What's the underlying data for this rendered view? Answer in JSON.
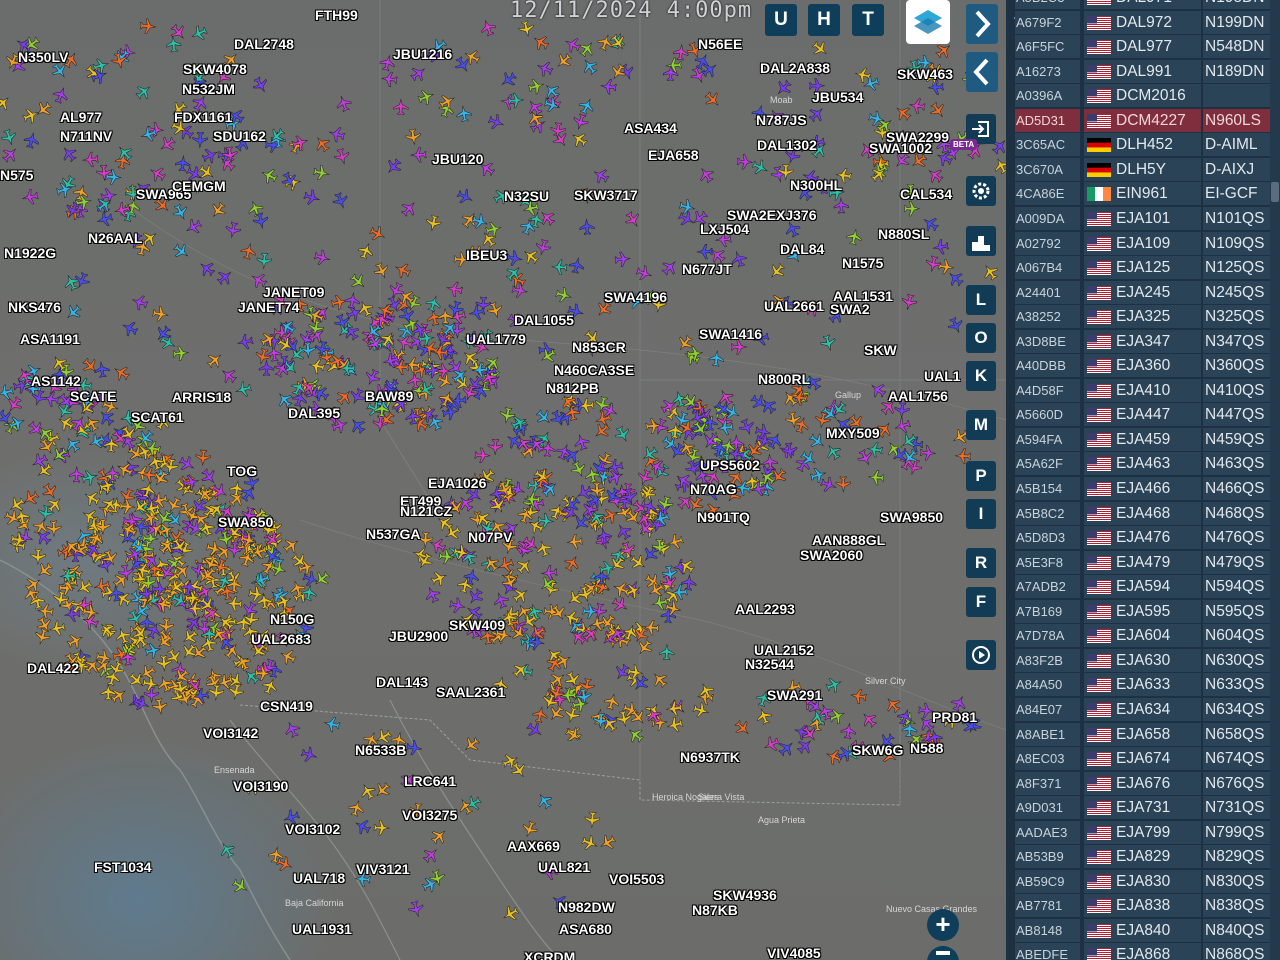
{
  "timestamp": "12/11/2024 4:00pm",
  "top_buttons": [
    "U",
    "H",
    "T"
  ],
  "side_buttons": [
    "L",
    "O",
    "K",
    "M",
    "P",
    "I",
    "R",
    "F"
  ],
  "beta_badge": "BETA",
  "zoom_in": "+",
  "places": [
    {
      "name": "Moab"
    },
    {
      "name": "Gallup"
    },
    {
      "name": "Silver City"
    },
    {
      "name": "Heroica Nogales"
    },
    {
      "name": "Sierra Vista"
    },
    {
      "name": "Agua Prieta"
    },
    {
      "name": "Ensenada"
    },
    {
      "name": "Nuevo Casas Grandes"
    },
    {
      "name": "Baja California"
    }
  ],
  "flights": [
    {
      "label": "FTH99"
    },
    {
      "label": "DAL2748"
    },
    {
      "label": "SKW4078"
    },
    {
      "label": "N532JM"
    },
    {
      "label": "JBU1216"
    },
    {
      "label": "N350LV"
    },
    {
      "label": "AL977"
    },
    {
      "label": "N711NV"
    },
    {
      "label": "FDX1161"
    },
    {
      "label": "SDU162"
    },
    {
      "label": "N56EE"
    },
    {
      "label": "DAL2A838"
    },
    {
      "label": "SKW463"
    },
    {
      "label": "JBU534"
    },
    {
      "label": "N787JS"
    },
    {
      "label": "DAL1302"
    },
    {
      "label": "SWA1002"
    },
    {
      "label": "ASA434"
    },
    {
      "label": "EJA658"
    },
    {
      "label": "N300HL"
    },
    {
      "label": "CAL534"
    },
    {
      "label": "SWA965"
    },
    {
      "label": "N32SU"
    },
    {
      "label": "SKW3717"
    },
    {
      "label": "LXJ504"
    },
    {
      "label": "SWA2EXJ376"
    },
    {
      "label": "JANET09"
    },
    {
      "label": "ASA1191"
    },
    {
      "label": "NKS476"
    },
    {
      "label": "N1922G"
    },
    {
      "label": "SWA4196"
    },
    {
      "label": "SWA1416"
    },
    {
      "label": "UAL2661"
    },
    {
      "label": "N677JT"
    },
    {
      "label": "DAL1055"
    },
    {
      "label": "N853CR"
    },
    {
      "label": "N460CA3SE"
    },
    {
      "label": "N812PB"
    },
    {
      "label": "N800RL"
    },
    {
      "label": "AAL1756"
    },
    {
      "label": "ARRIS18"
    },
    {
      "label": "SCAT61"
    },
    {
      "label": "AS1142"
    },
    {
      "label": "MXY509"
    },
    {
      "label": "UPS5602"
    },
    {
      "label": "N901TQ"
    },
    {
      "label": "N70AG"
    },
    {
      "label": "SWA2060"
    },
    {
      "label": "AAN888GL"
    },
    {
      "label": "N537GA"
    },
    {
      "label": "JBU2900"
    },
    {
      "label": "SKW409"
    },
    {
      "label": "AAL2293"
    },
    {
      "label": "UAL2152"
    },
    {
      "label": "N32544"
    },
    {
      "label": "SWA291"
    },
    {
      "label": "DAL422"
    },
    {
      "label": "SAAL2361"
    },
    {
      "label": "CSN419"
    },
    {
      "label": "VOI3142"
    },
    {
      "label": "VOI3190"
    },
    {
      "label": "LRC641"
    },
    {
      "label": "N6533B"
    },
    {
      "label": "VOI3275"
    },
    {
      "label": "VOI3102"
    },
    {
      "label": "AAX669"
    },
    {
      "label": "UAL821"
    },
    {
      "label": "VOI5503"
    },
    {
      "label": "FST1034"
    },
    {
      "label": "UAL718"
    },
    {
      "label": "VIV3121"
    },
    {
      "label": "UAL1931"
    },
    {
      "label": "N982DW"
    },
    {
      "label": "ASA680"
    },
    {
      "label": "SKW4936"
    },
    {
      "label": "N87KB"
    },
    {
      "label": "VIV4085"
    },
    {
      "label": "N6937TK"
    },
    {
      "label": "PRD81"
    },
    {
      "label": "N588"
    },
    {
      "label": "SKW6G"
    },
    {
      "label": "DAL84"
    },
    {
      "label": "N880SL"
    },
    {
      "label": "JANET74"
    },
    {
      "label": "SCATE"
    },
    {
      "label": "TOG"
    },
    {
      "label": "UAL1779"
    },
    {
      "label": "BAW89"
    },
    {
      "label": "ET499"
    },
    {
      "label": "N121CZ"
    },
    {
      "label": "N07PV"
    },
    {
      "label": "SWA850"
    },
    {
      "label": "EJA1026"
    },
    {
      "label": "IBEU3"
    },
    {
      "label": "XCRDM"
    },
    {
      "label": "DAL395"
    },
    {
      "label": "SWA9850"
    },
    {
      "label": "N150G"
    },
    {
      "label": "UAL2683"
    },
    {
      "label": "DAL143"
    },
    {
      "label": "N1575"
    },
    {
      "label": "AAL1531"
    },
    {
      "label": "SKW"
    },
    {
      "label": "SWA2"
    },
    {
      "label": "N575"
    },
    {
      "label": "N26AAL"
    },
    {
      "label": "CEMGM"
    },
    {
      "label": "UAL1"
    },
    {
      "label": "JBU120"
    },
    {
      "label": "SWA2299"
    }
  ],
  "aircraft_list": [
    {
      "hex": "A5B2C3",
      "country": "us",
      "callsign": "DAL971",
      "reg": "N198DN"
    },
    {
      "hex": "A679F2",
      "country": "us",
      "callsign": "DAL972",
      "reg": "N199DN"
    },
    {
      "hex": "A6F5FC",
      "country": "us",
      "callsign": "DAL977",
      "reg": "N548DN"
    },
    {
      "hex": "A16273",
      "country": "us",
      "callsign": "DAL991",
      "reg": "N189DN"
    },
    {
      "hex": "A0396A",
      "country": "us",
      "callsign": "DCM2016",
      "reg": ""
    },
    {
      "hex": "AD5D31",
      "country": "us",
      "callsign": "DCM4227",
      "reg": "N960LS",
      "selected": true
    },
    {
      "hex": "3C65AC",
      "country": "de",
      "callsign": "DLH452",
      "reg": "D-AIML"
    },
    {
      "hex": "3C670A",
      "country": "de",
      "callsign": "DLH5Y",
      "reg": "D-AIXJ"
    },
    {
      "hex": "4CA86E",
      "country": "ie",
      "callsign": "EIN961",
      "reg": "EI-GCF"
    },
    {
      "hex": "A009DA",
      "country": "us",
      "callsign": "EJA101",
      "reg": "N101QS"
    },
    {
      "hex": "A02792",
      "country": "us",
      "callsign": "EJA109",
      "reg": "N109QS"
    },
    {
      "hex": "A067B4",
      "country": "us",
      "callsign": "EJA125",
      "reg": "N125QS"
    },
    {
      "hex": "A24401",
      "country": "us",
      "callsign": "EJA245",
      "reg": "N245QS"
    },
    {
      "hex": "A38252",
      "country": "us",
      "callsign": "EJA325",
      "reg": "N325QS"
    },
    {
      "hex": "A3D8BE",
      "country": "us",
      "callsign": "EJA347",
      "reg": "N347QS"
    },
    {
      "hex": "A40DBB",
      "country": "us",
      "callsign": "EJA360",
      "reg": "N360QS"
    },
    {
      "hex": "A4D58F",
      "country": "us",
      "callsign": "EJA410",
      "reg": "N410QS"
    },
    {
      "hex": "A5660D",
      "country": "us",
      "callsign": "EJA447",
      "reg": "N447QS"
    },
    {
      "hex": "A594FA",
      "country": "us",
      "callsign": "EJA459",
      "reg": "N459QS"
    },
    {
      "hex": "A5A62F",
      "country": "us",
      "callsign": "EJA463",
      "reg": "N463QS"
    },
    {
      "hex": "A5B154",
      "country": "us",
      "callsign": "EJA466",
      "reg": "N466QS"
    },
    {
      "hex": "A5B8C2",
      "country": "us",
      "callsign": "EJA468",
      "reg": "N468QS"
    },
    {
      "hex": "A5D8D3",
      "country": "us",
      "callsign": "EJA476",
      "reg": "N476QS"
    },
    {
      "hex": "A5E3F8",
      "country": "us",
      "callsign": "EJA479",
      "reg": "N479QS"
    },
    {
      "hex": "A7ADB2",
      "country": "us",
      "callsign": "EJA594",
      "reg": "N594QS"
    },
    {
      "hex": "A7B169",
      "country": "us",
      "callsign": "EJA595",
      "reg": "N595QS"
    },
    {
      "hex": "A7D78A",
      "country": "us",
      "callsign": "EJA604",
      "reg": "N604QS"
    },
    {
      "hex": "A83F2B",
      "country": "us",
      "callsign": "EJA630",
      "reg": "N630QS"
    },
    {
      "hex": "A84A50",
      "country": "us",
      "callsign": "EJA633",
      "reg": "N633QS"
    },
    {
      "hex": "A84E07",
      "country": "us",
      "callsign": "EJA634",
      "reg": "N634QS"
    },
    {
      "hex": "A8ABE1",
      "country": "us",
      "callsign": "EJA658",
      "reg": "N658QS"
    },
    {
      "hex": "A8EC03",
      "country": "us",
      "callsign": "EJA674",
      "reg": "N674QS"
    },
    {
      "hex": "A8F371",
      "country": "us",
      "callsign": "EJA676",
      "reg": "N676QS"
    },
    {
      "hex": "A9D031",
      "country": "us",
      "callsign": "EJA731",
      "reg": "N731QS"
    },
    {
      "hex": "AADAE3",
      "country": "us",
      "callsign": "EJA799",
      "reg": "N799QS"
    },
    {
      "hex": "AB53B9",
      "country": "us",
      "callsign": "EJA829",
      "reg": "N829QS"
    },
    {
      "hex": "AB59C9",
      "country": "us",
      "callsign": "EJA830",
      "reg": "N830QS"
    },
    {
      "hex": "AB7781",
      "country": "us",
      "callsign": "EJA838",
      "reg": "N838QS"
    },
    {
      "hex": "AB8148",
      "country": "us",
      "callsign": "EJA840",
      "reg": "N840QS"
    },
    {
      "hex": "ABEDFE",
      "country": "us",
      "callsign": "EJA868",
      "reg": "N868QS"
    }
  ],
  "plane_colors": [
    "#a63cf0",
    "#7b3cf0",
    "#4a4cf0",
    "#c23ce0",
    "#f0a024",
    "#e8c020",
    "#34b4e8",
    "#2cc0a8",
    "#90d030",
    "#f06c24",
    "#d83cc8"
  ]
}
